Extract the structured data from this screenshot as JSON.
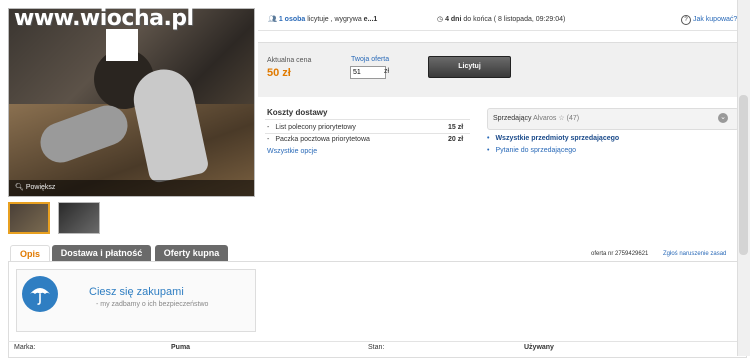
{
  "watermark": "www.wiocha.pl",
  "photo": {
    "zoom_label": "Powiększ"
  },
  "bidders": {
    "count": "1 osoba",
    "text": "licytuje , wygrywa",
    "winner": "e...1"
  },
  "timer": {
    "remaining": "4 dni",
    "text": "do końca ( 8 listopada, 09:29:04)"
  },
  "help": {
    "label": "Jak kupować?"
  },
  "price": {
    "label": "Aktualna cena",
    "value": "50 zł"
  },
  "bid": {
    "label": "Twoja oferta",
    "value": "51",
    "currency": "zł",
    "button": "Licytuj"
  },
  "shipping": {
    "title": "Koszty dostawy",
    "items": [
      {
        "name": "List polecony priorytetowy",
        "price": "15 zł"
      },
      {
        "name": "Paczka pocztowa priorytetowa",
        "price": "20 zł"
      }
    ],
    "all_link": "Wszystkie opcje"
  },
  "seller": {
    "label": "Sprzedający",
    "name": "Alvaros",
    "rating": "(47)",
    "links": [
      "Wszystkie przedmioty sprzedającego",
      "Pytanie do sprzedającego"
    ]
  },
  "tabs": [
    "Opis",
    "Dostawa i płatność",
    "Oferty kupna"
  ],
  "offer": {
    "number": "oferta nr 2759429621",
    "report": "Zgłoś naruszenie zasad"
  },
  "safe": {
    "title": "Ciesz się zakupami",
    "subtitle": "my zadbamy o ich bezpieczeństwo"
  },
  "params": {
    "brand_label": "Marka:",
    "brand_value": "Puma",
    "state_label": "Stan:",
    "state_value": "Używany"
  },
  "colors": {
    "accent": "#e07a00",
    "link": "#2a6ab8",
    "safe_blue": "#2f7ec2"
  }
}
